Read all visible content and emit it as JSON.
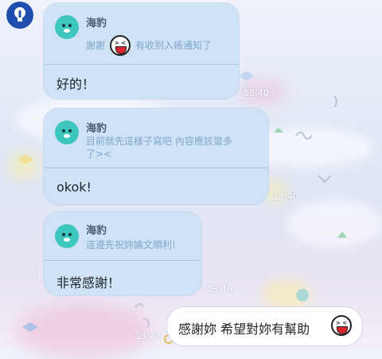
{
  "messages": [
    {
      "sender": "海豹",
      "quote_parts": [
        "謝謝",
        "有收到入帳通知了"
      ],
      "text": "好的！",
      "time": "13:40"
    },
    {
      "sender": "海豹",
      "quote_lines": [
        "目前就先這樣子寫吧 內容應該蠻多",
        "了><"
      ],
      "text": "okok!",
      "time": "13:40"
    },
    {
      "sender": "海豹",
      "quote": "這邊先祝妳論文順利!",
      "text": "非常感謝！",
      "time": "13:40"
    }
  ],
  "outgoing": {
    "text": "感謝妳 希望對妳有幫助",
    "time": "13:42"
  },
  "icons": {
    "avatar": "lightbulb-icon",
    "sender_avatar": "seal-icon",
    "sticker": "laughing-face-sticker"
  },
  "colors": {
    "incoming_bubble": "#cfe3f7",
    "outgoing_bubble": "#ffffff",
    "avatar_bg": "#1e4fae",
    "seal": "#3cc6bd"
  }
}
